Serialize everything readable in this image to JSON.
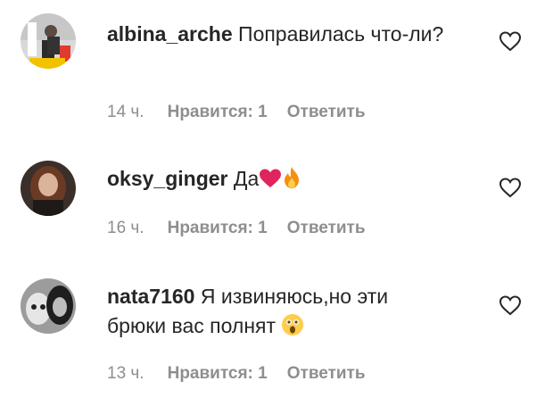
{
  "comments": [
    {
      "username": "albina_arche",
      "text": "Поправилась что-ли?",
      "time": "14 ч.",
      "likes_label": "Нравится: 1",
      "reply_label": "Ответить",
      "avatar_icon": "avatar-photo"
    },
    {
      "username": "oksy_ginger",
      "text": "Да",
      "emojis": [
        "red-heart-emoji",
        "fire-emoji"
      ],
      "time": "16 ч.",
      "likes_label": "Нравится: 1",
      "reply_label": "Ответить",
      "avatar_icon": "avatar-photo"
    },
    {
      "username": "nata7160",
      "text": "Я извиняюсь,но эти брюки вас полнят",
      "emojis": [
        "astonished-face-emoji"
      ],
      "time": "13 ч.",
      "likes_label": "Нравится: 1",
      "reply_label": "Ответить",
      "avatar_icon": "avatar-photo"
    }
  ],
  "colors": {
    "text": "#262626",
    "meta": "#8e8e8e",
    "heart_emoji": "#e0245e",
    "fire_emoji": "#f4900c"
  }
}
